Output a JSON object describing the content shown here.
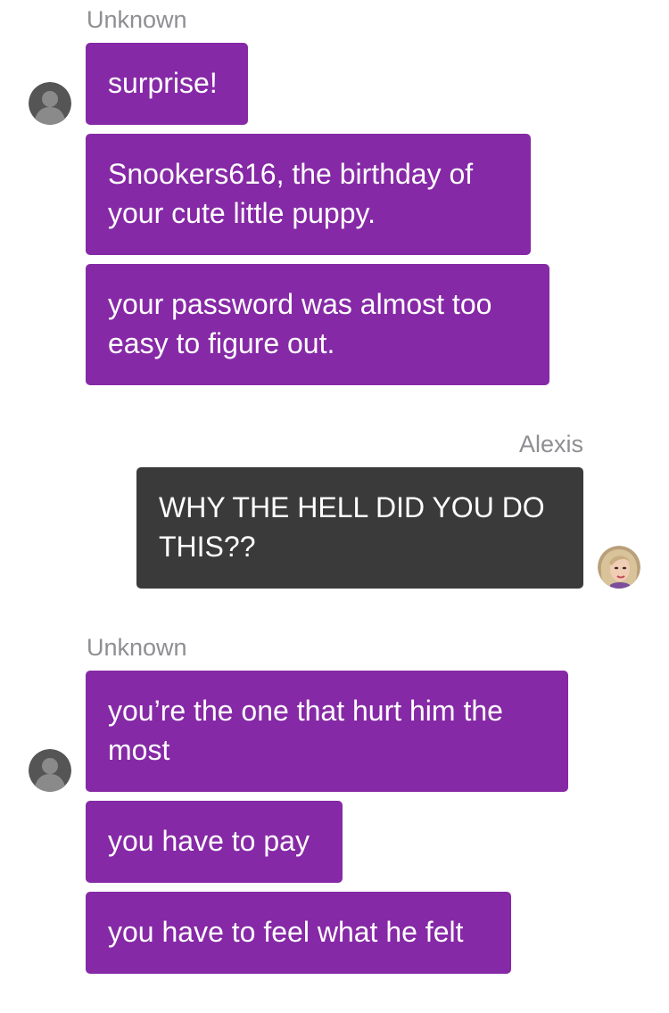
{
  "conversation": {
    "groups": [
      {
        "sender": "Unknown",
        "direction": "incoming",
        "avatar_icon": "default-user-avatar-icon",
        "messages": [
          "surprise!",
          "Snookers616, the birthday of your cute little puppy.",
          "your password was almost too easy to figure out."
        ]
      },
      {
        "sender": "Alexis",
        "direction": "outgoing",
        "avatar_icon": "alexis-avatar-icon",
        "messages": [
          "WHY THE HELL DID YOU DO THIS??"
        ]
      },
      {
        "sender": "Unknown",
        "direction": "incoming",
        "avatar_icon": "default-user-avatar-icon",
        "messages": [
          "you’re the one that hurt him the most",
          "you have to pay",
          "you have to feel what he felt"
        ]
      }
    ]
  },
  "colors": {
    "incoming_bubble": "#8629a6",
    "outgoing_bubble": "#3a3a3a",
    "sender_name": "#8e8e93",
    "bubble_text": "#ffffff"
  }
}
